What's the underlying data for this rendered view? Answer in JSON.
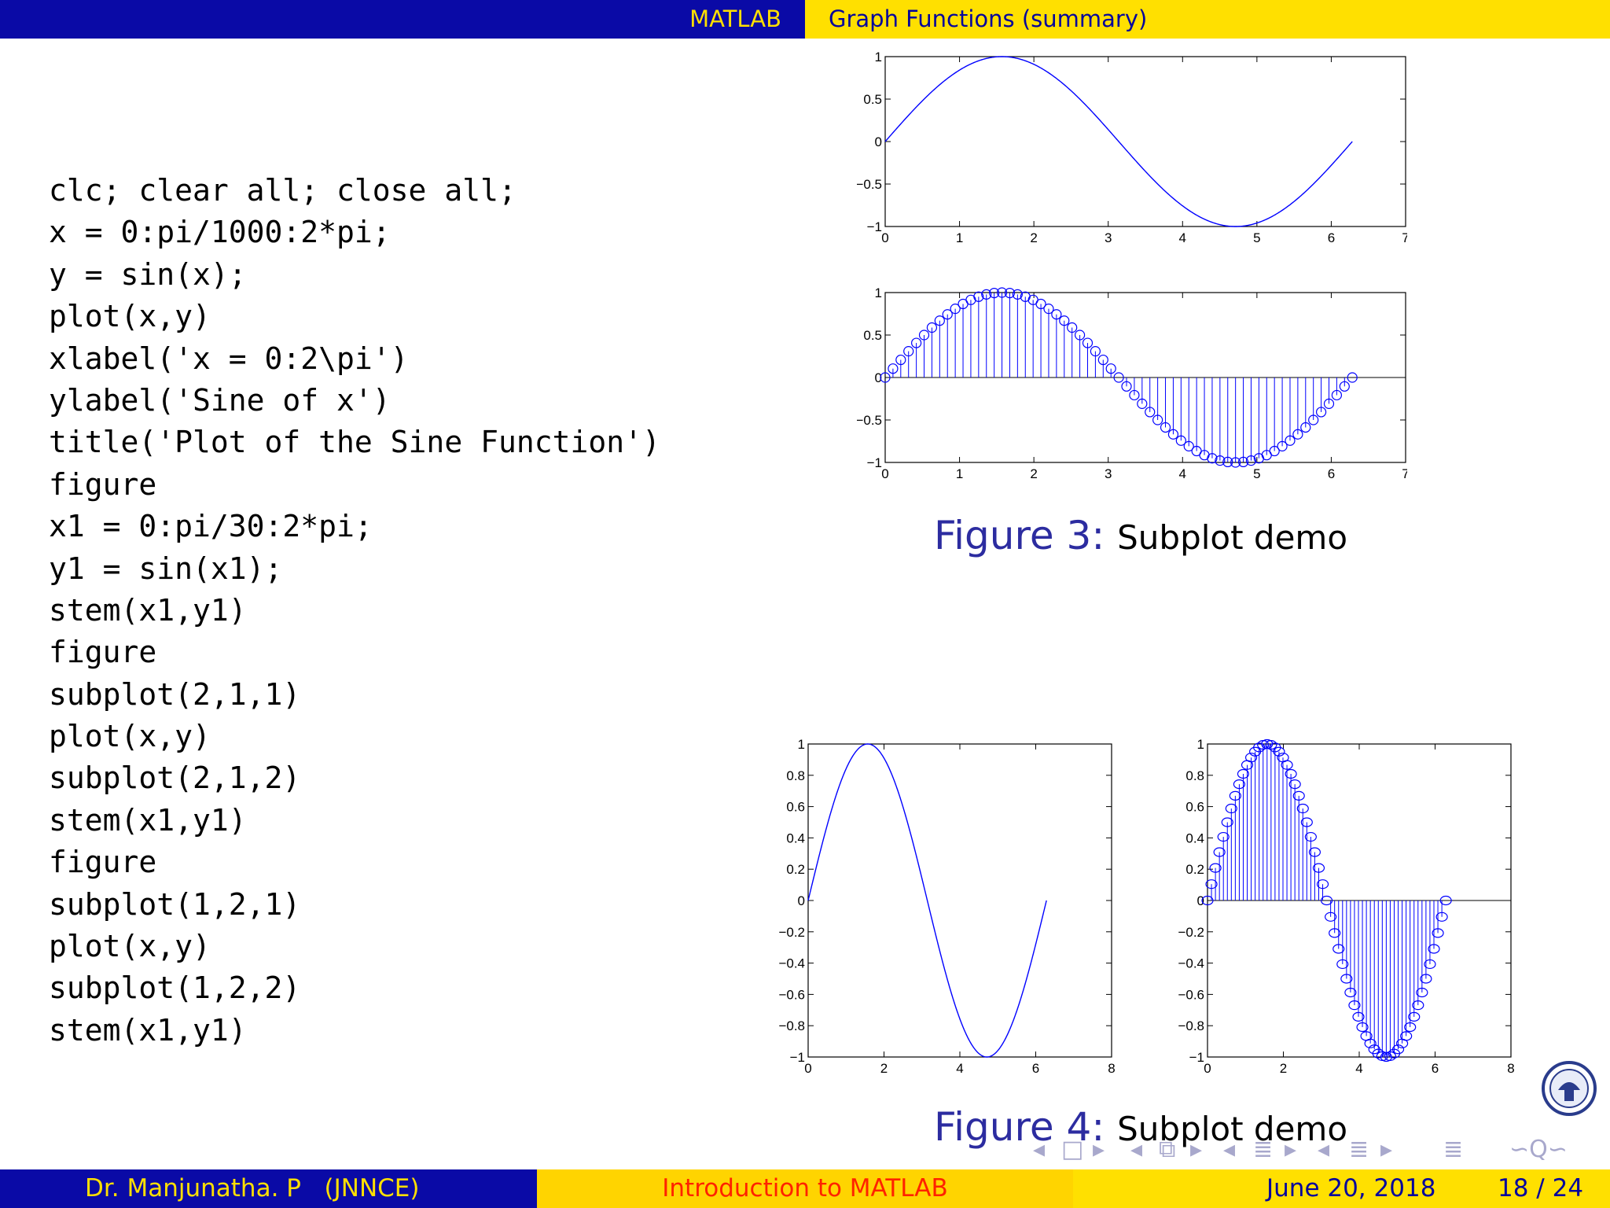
{
  "header": {
    "left": "MATLAB",
    "right": "Graph Functions (summary)"
  },
  "code_lines": [
    "clc; clear all; close all;",
    "x = 0:pi/1000:2*pi;",
    "y = sin(x);",
    "plot(x,y)",
    "xlabel('x = 0:2\\pi')",
    "ylabel('Sine of x')",
    "title('Plot of the Sine Function')",
    "figure",
    "x1 = 0:pi/30:2*pi;",
    "y1 = sin(x1);",
    "stem(x1,y1)",
    "figure",
    "subplot(2,1,1)",
    "plot(x,y)",
    "subplot(2,1,2)",
    "stem(x1,y1)",
    "figure",
    "subplot(1,2,1)",
    "plot(x,y)",
    "subplot(1,2,2)",
    "stem(x1,y1)"
  ],
  "figure3": {
    "label": "Figure 3:",
    "caption": "Subplot demo"
  },
  "figure4": {
    "label": "Figure 4:",
    "caption": "Subplot demo"
  },
  "footer": {
    "author": "Dr. Manjunatha. P   (JNNCE)",
    "title": "Introduction to MATLAB",
    "date": "June 20, 2018",
    "page": "18 / 24"
  },
  "colors": {
    "plot_line": "#0000ff",
    "header_blue": "#0a0aa6",
    "header_yellow": "#ffe000"
  },
  "chart_data": [
    {
      "type": "line",
      "function": "sin(x)",
      "x_range": [
        0,
        6.2832
      ],
      "x_step": "pi/1000",
      "xlim": [
        0,
        7
      ],
      "ylim": [
        -1,
        1
      ],
      "xticks": [
        "0",
        "1",
        "2",
        "3",
        "4",
        "5",
        "6",
        "7"
      ],
      "yticks": [
        "1",
        "0.5",
        "0",
        "−0.5",
        "−1"
      ],
      "grid": false
    },
    {
      "type": "stem",
      "function": "sin(x1)",
      "x_range": [
        0,
        6.2832
      ],
      "x_step": "pi/30",
      "xlim": [
        0,
        7
      ],
      "ylim": [
        -1,
        1
      ],
      "xticks": [
        "0",
        "1",
        "2",
        "3",
        "4",
        "5",
        "6",
        "7"
      ],
      "yticks": [
        "1",
        "0.5",
        "0",
        "−0.5",
        "−1"
      ],
      "grid": false
    },
    {
      "type": "line",
      "function": "sin(x)",
      "x_range": [
        0,
        6.2832
      ],
      "x_step": "pi/1000",
      "xlim": [
        0,
        8
      ],
      "ylim": [
        -1,
        1
      ],
      "xticks": [
        "0",
        "2",
        "4",
        "6",
        "8"
      ],
      "yticks": [
        "1",
        "0.8",
        "0.6",
        "0.4",
        "0.2",
        "0",
        "−0.2",
        "−0.4",
        "−0.6",
        "−0.8",
        "−1"
      ],
      "grid": false
    },
    {
      "type": "stem",
      "function": "sin(x1)",
      "x_range": [
        0,
        6.2832
      ],
      "x_step": "pi/30",
      "xlim": [
        0,
        8
      ],
      "ylim": [
        -1,
        1
      ],
      "xticks": [
        "0",
        "2",
        "4",
        "6",
        "8"
      ],
      "yticks": [
        "1",
        "0.8",
        "0.6",
        "0.4",
        "0.2",
        "0",
        "−0.2",
        "−0.4",
        "−0.6",
        "−0.8",
        "−1"
      ],
      "grid": false
    }
  ]
}
